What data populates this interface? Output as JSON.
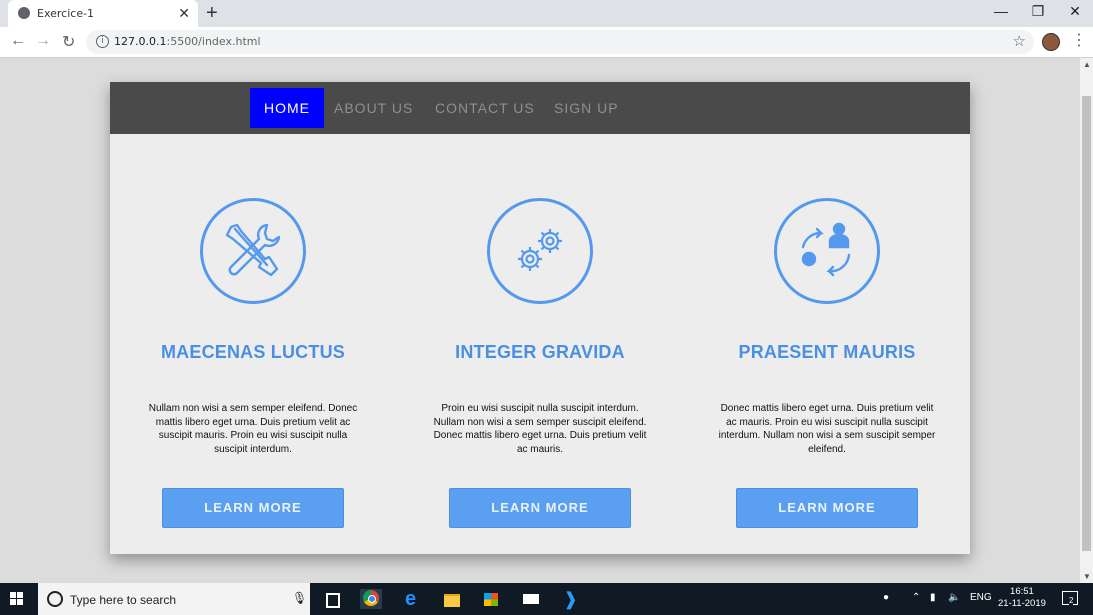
{
  "browser": {
    "tab_title": "Exercice-1",
    "tab_close": "✕",
    "new_tab": "+",
    "url_host": "127.0.0.1",
    "url_path": ":5500/index.html",
    "minimize": "—",
    "restore": "❐",
    "close": "✕"
  },
  "nav": {
    "items": [
      "HOME",
      "ABOUT US",
      "CONTACT US",
      "SIGN UP"
    ],
    "active": "HOME"
  },
  "features": [
    {
      "title": "MAECENAS LUCTUS",
      "body": "Nullam non wisi a sem semper eleifend. Donec mattis libero eget urna. Duis pretium velit ac suscipit mauris. Proin eu wisi suscipit nulla suscipit interdum.",
      "button": "LEARN MORE",
      "icon": "tools-icon"
    },
    {
      "title": "INTEGER GRAVIDA",
      "body": "Proin eu wisi suscipit nulla suscipit interdum. Nullam non wisi a sem semper suscipit eleifend. Donec mattis libero eget urna. Duis pretium velit ac mauris.",
      "button": "LEARN MORE",
      "icon": "gears-icon"
    },
    {
      "title": "PRAESENT MAURIS",
      "body": "Donec mattis libero eget urna. Duis pretium velit ac mauris. Proin eu wisi suscipit nulla suscipit interdum. Nullam non wisi a sem suscipit semper eleifend.",
      "button": "LEARN MORE",
      "icon": "user-process-icon"
    }
  ],
  "taskbar": {
    "search_placeholder": "Type here to search",
    "lang": "ENG",
    "time": "16:51",
    "date": "21-11-2019",
    "notifications": "2"
  },
  "colors": {
    "accent": "#4a90e2",
    "nav_active": "#0000ff",
    "navbar": "#4a4a4a",
    "button": "#5b9ff0"
  }
}
